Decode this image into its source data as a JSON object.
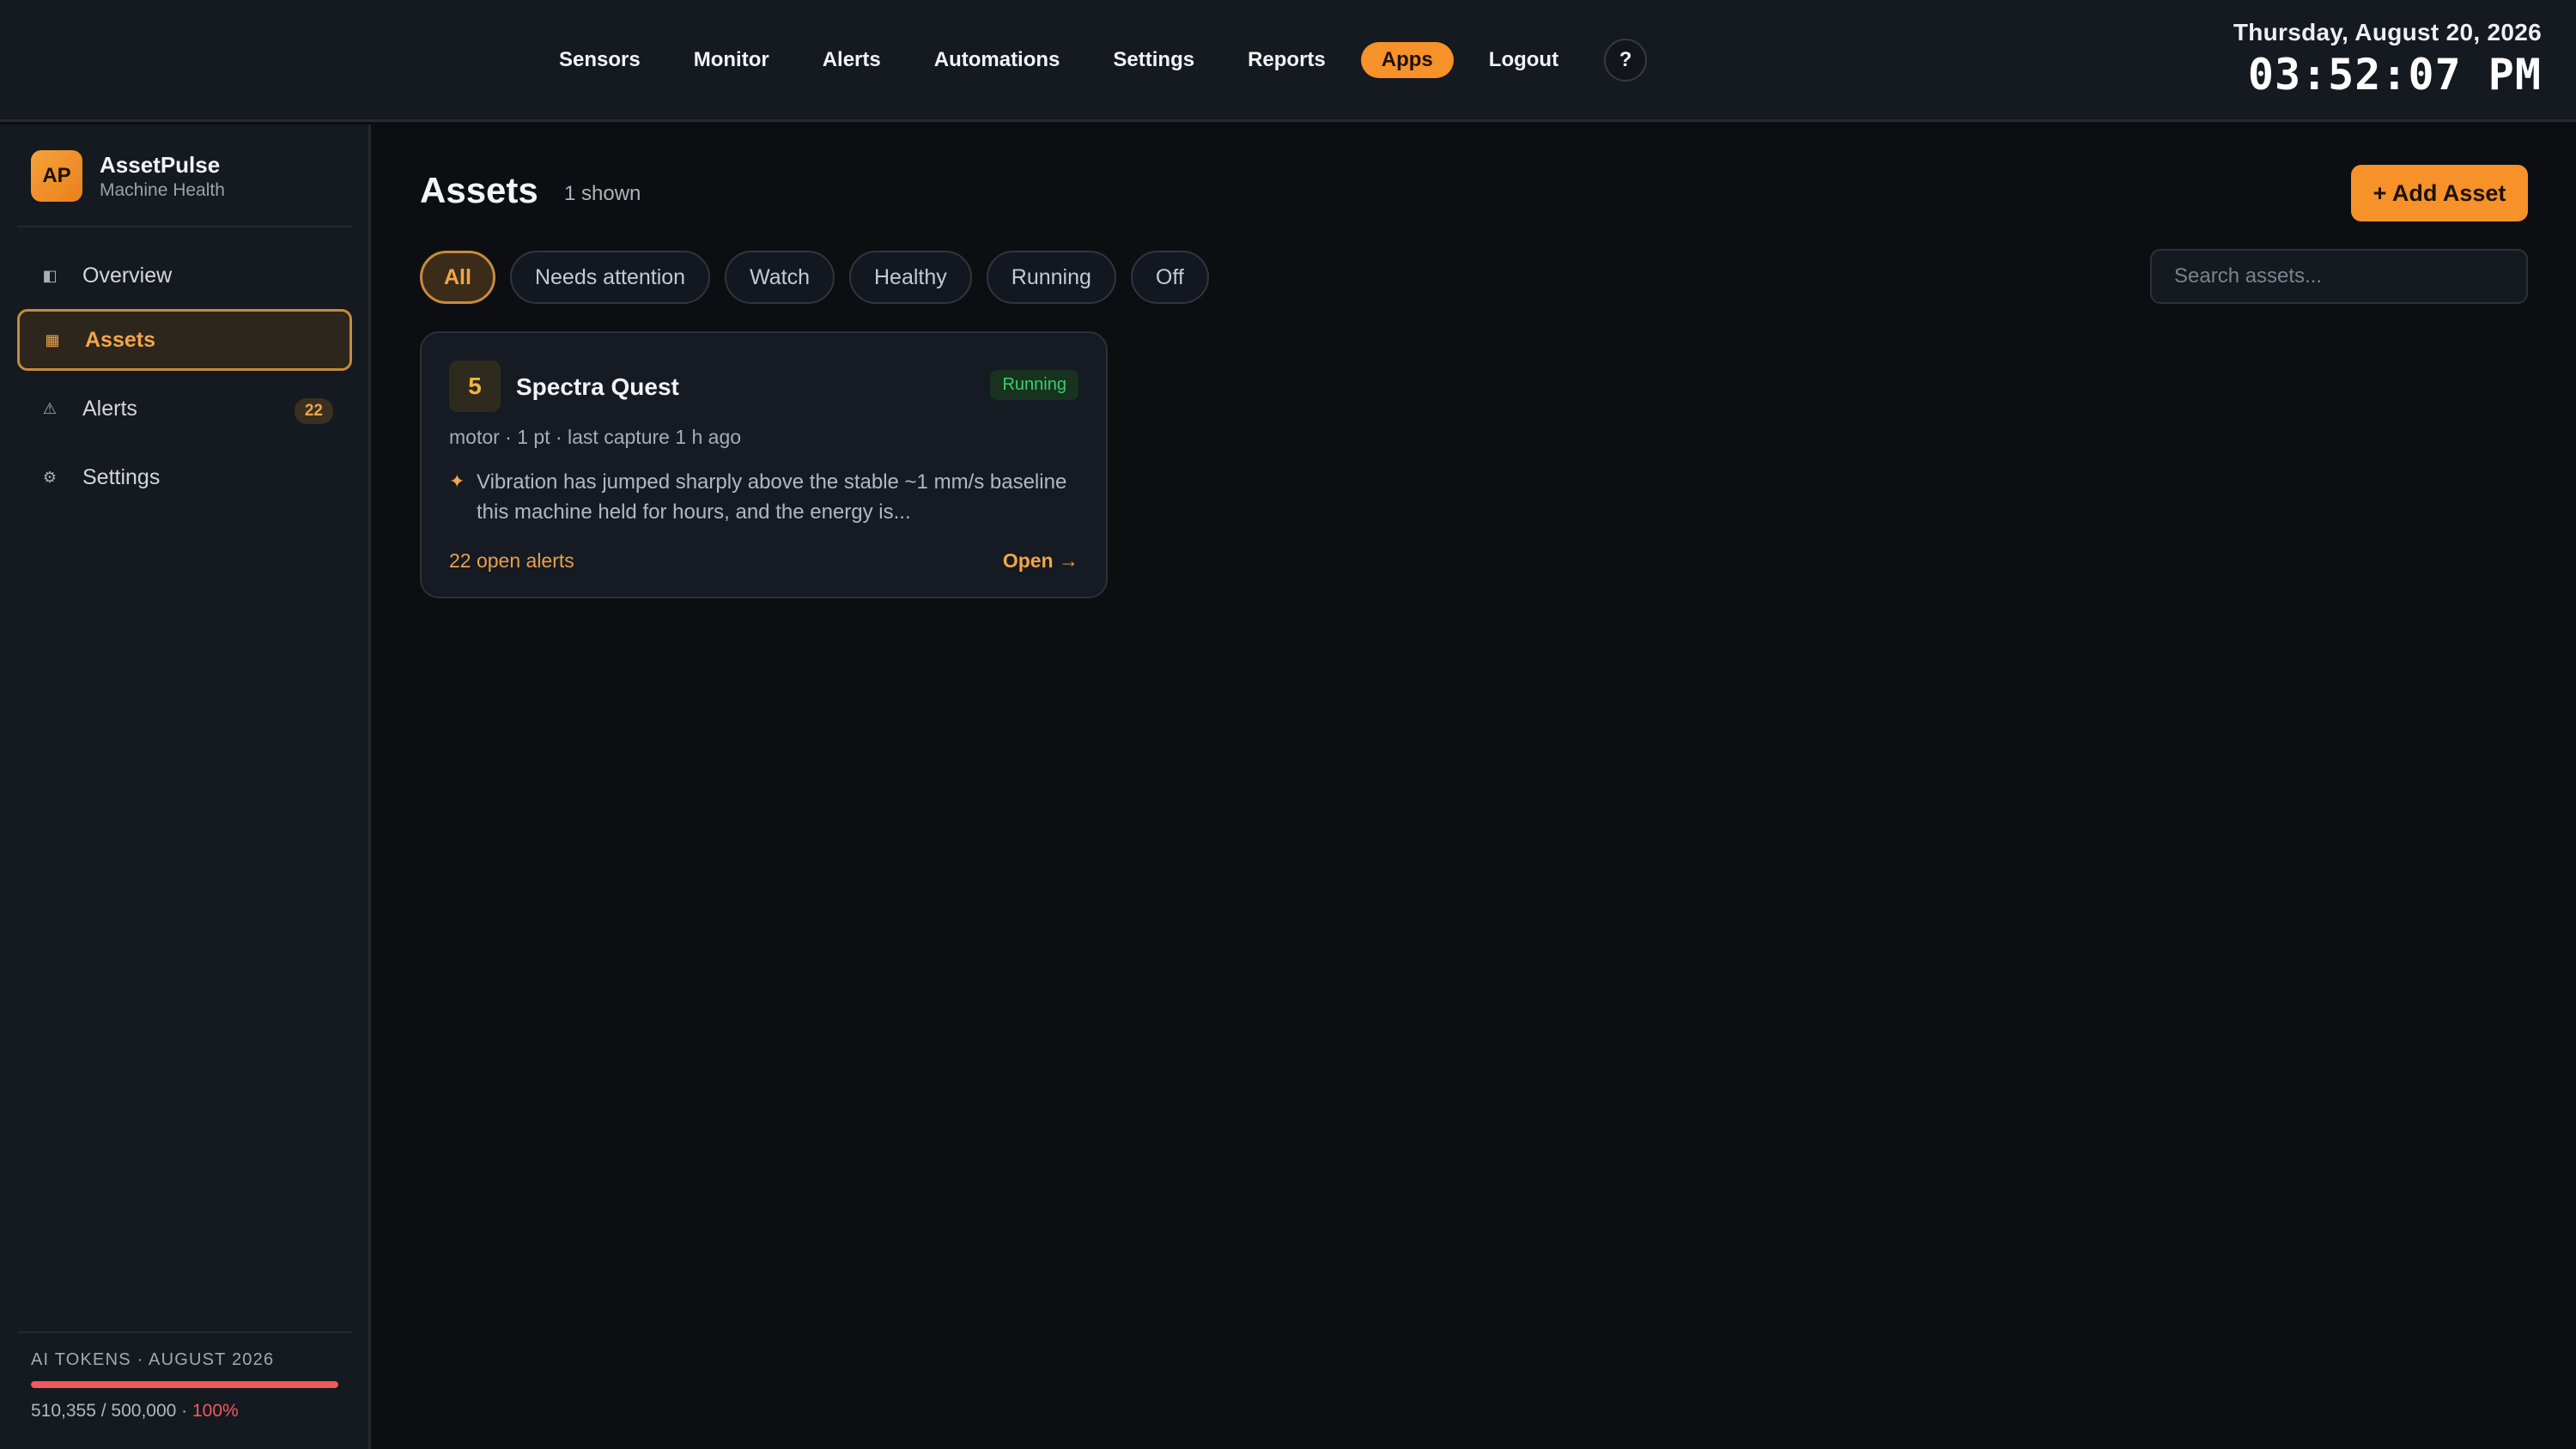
{
  "topnav": {
    "items": [
      "Sensors",
      "Monitor",
      "Alerts",
      "Automations",
      "Settings",
      "Reports"
    ],
    "active_item": "Apps",
    "logout": "Logout",
    "help": "?"
  },
  "clock": {
    "date": "Thursday, August 20, 2026",
    "time": "03:52:07 PM"
  },
  "brand": {
    "logo": "AP",
    "name": "AssetPulse",
    "subtitle": "Machine Health"
  },
  "sidebar": {
    "items": [
      {
        "label": "Overview",
        "icon": "overview-icon"
      },
      {
        "label": "Assets",
        "icon": "grid-icon"
      },
      {
        "label": "Alerts",
        "icon": "warning-icon",
        "badge": "22"
      },
      {
        "label": "Settings",
        "icon": "gear-icon"
      }
    ]
  },
  "tokens": {
    "label": "AI TOKENS · AUGUST 2026",
    "usage": "510,355 / 500,000 · ",
    "percent": "100%",
    "fill_fraction": 1.0
  },
  "main": {
    "title": "Assets",
    "count": "1 shown",
    "add_button": "+ Add Asset",
    "filters": [
      "All",
      "Needs attention",
      "Watch",
      "Healthy",
      "Running",
      "Off"
    ],
    "search_placeholder": "Search assets..."
  },
  "card": {
    "number": "5",
    "title": "Spectra Quest",
    "status": "Running",
    "meta": "motor · 1 pt · last capture 1 h ago",
    "note": "Vibration has jumped sharply above the stable ~1 mm/s baseline this machine held for hours, and the energy is...",
    "alerts": "22 open alerts",
    "open": "Open →"
  },
  "colors": {
    "accent": "#f7912a",
    "status_running": "#3dcc6a",
    "token_bar": "#ef5b5b"
  }
}
